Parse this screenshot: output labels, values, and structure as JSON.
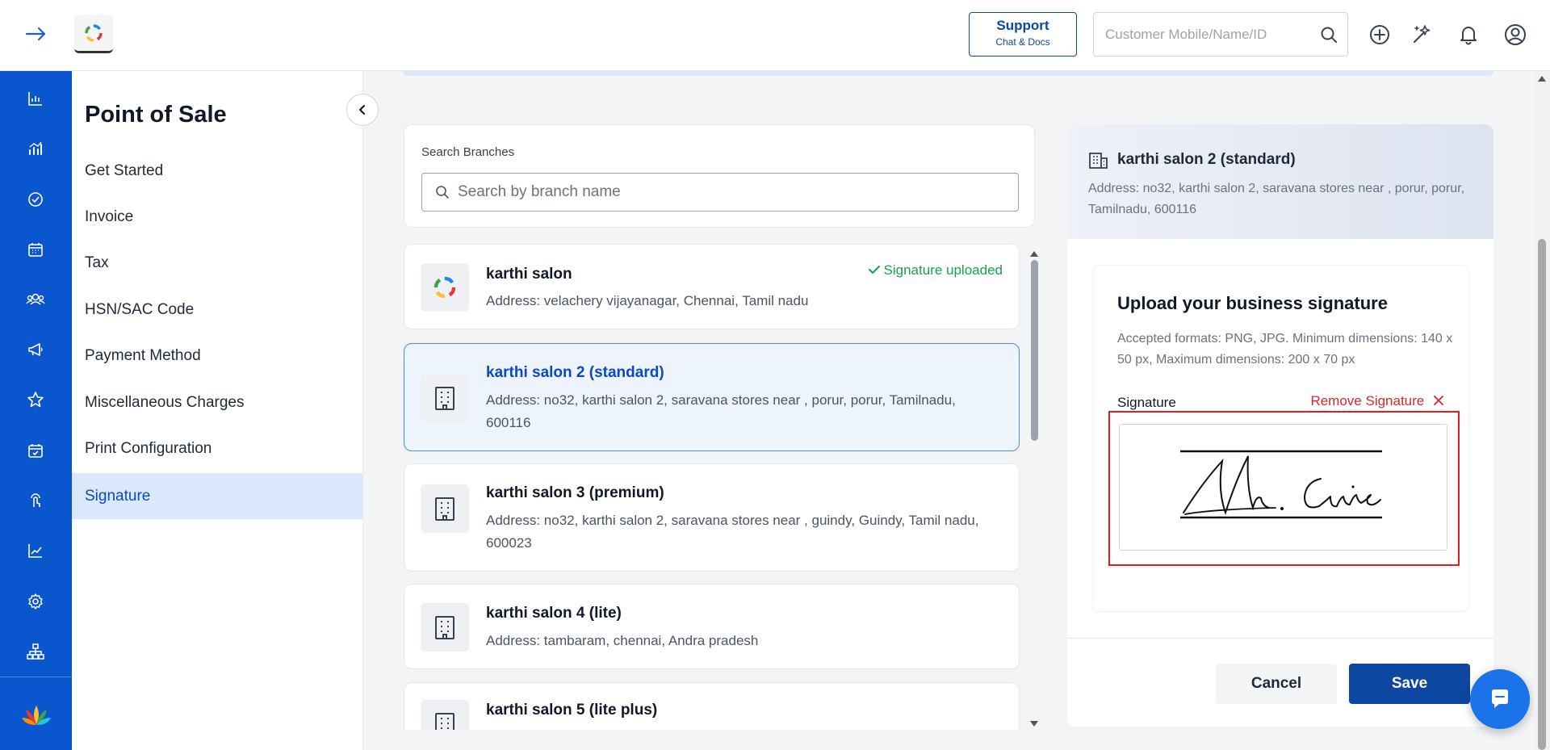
{
  "header": {
    "support_title": "Support",
    "support_sub": "Chat & Docs",
    "search_placeholder": "Customer Mobile/Name/ID"
  },
  "sidebar": {
    "title": "Point of Sale",
    "items": [
      {
        "label": "Get Started"
      },
      {
        "label": "Invoice"
      },
      {
        "label": "Tax"
      },
      {
        "label": "HSN/SAC Code"
      },
      {
        "label": "Payment Method"
      },
      {
        "label": "Miscellaneous Charges"
      },
      {
        "label": "Print Configuration"
      },
      {
        "label": "Signature",
        "active": true
      }
    ]
  },
  "search": {
    "label": "Search Branches",
    "placeholder": "Search by branch name"
  },
  "branches": [
    {
      "name": "karthi salon",
      "address": "Address: velachery vijayanagar, Chennai, Tamil nadu",
      "badge": "Signature uploaded"
    },
    {
      "name": "karthi salon 2 (standard)",
      "address": "Address: no32, karthi salon 2, saravana stores near , porur, porur, Tamilnadu, 600116",
      "selected": true
    },
    {
      "name": "karthi salon 3 (premium)",
      "address": "Address: no32, karthi salon 2, saravana stores near , guindy, Guindy, Tamil nadu, 600023"
    },
    {
      "name": "karthi salon 4 (lite)",
      "address": "Address: tambaram, chennai, Andra pradesh"
    },
    {
      "name": "karthi salon 5 (lite plus)",
      "address": ""
    }
  ],
  "detail": {
    "name": "karthi salon 2 (standard)",
    "address": "Address: no32, karthi salon 2, saravana stores near , porur, porur, Tamilnadu, 600116",
    "upload_title": "Upload your business signature",
    "upload_desc": "Accepted formats: PNG, JPG. Minimum dimensions: 140 x 50 px, Maximum dimensions: 200 x 70 px",
    "signature_label": "Signature",
    "remove_label": "Remove Signature",
    "cancel_label": "Cancel",
    "save_label": "Save"
  },
  "colors": {
    "rail": "#0a56cf",
    "accent": "#0d47a1",
    "active_bg": "#dbe8fb",
    "success": "#16a34a",
    "danger": "#dc2626"
  },
  "icons": {
    "rail": [
      "bar-chart-icon",
      "analytics-icon",
      "check-circle-icon",
      "calendar-icon",
      "users-icon",
      "megaphone-icon",
      "star-icon",
      "calendar-check-icon",
      "touch-icon",
      "trend-icon",
      "settings-icon",
      "hierarchy-icon"
    ]
  }
}
